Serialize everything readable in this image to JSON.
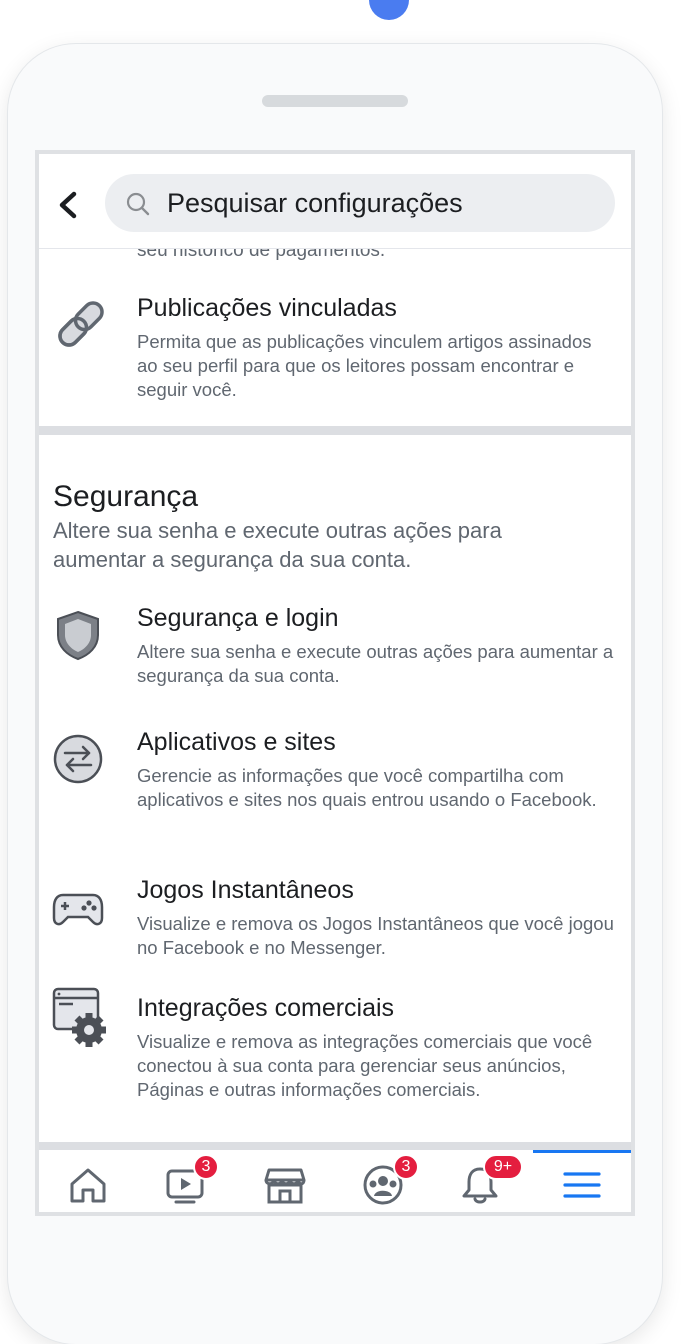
{
  "header": {
    "search_placeholder": "Pesquisar configurações",
    "cutoff_text": "seu histórico de pagamentos."
  },
  "linked_publications": {
    "title": "Publicações vinculadas",
    "description": "Permita que as publicações vinculem artigos assinados ao seu perfil para que os leitores possam encontrar e seguir você."
  },
  "security_section": {
    "title": "Segurança",
    "description": "Altere sua senha e execute outras ações para aumentar a segurança da sua conta.",
    "items": [
      {
        "icon": "shield-icon",
        "title": "Segurança e login",
        "description": "Altere sua senha e execute outras ações para aumentar a segurança da sua conta."
      },
      {
        "icon": "arrows-exchange-icon",
        "title": "Aplicativos e sites",
        "description": "Gerencie as informações que você compartilha com aplicativos e sites nos quais entrou usando o Facebook."
      },
      {
        "icon": "gamepad-icon",
        "title": "Jogos Instantâneos",
        "description": "Visualize e remova os Jogos Instantâneos que você jogou no Facebook e no Messenger."
      },
      {
        "icon": "browser-gear-icon",
        "title": "Integrações comerciais",
        "description": "Visualize e remova as integrações comerciais que você conectou à sua conta para gerenciar seus anúncios, Páginas e outras informações comerciais."
      }
    ]
  },
  "tabbar": {
    "items": [
      {
        "icon": "home-icon",
        "badge": ""
      },
      {
        "icon": "video-icon",
        "badge": "3"
      },
      {
        "icon": "marketplace-icon",
        "badge": ""
      },
      {
        "icon": "groups-icon",
        "badge": "3"
      },
      {
        "icon": "bell-icon",
        "badge": "9+"
      },
      {
        "icon": "menu-icon",
        "badge": "",
        "active": true
      }
    ]
  },
  "colors": {
    "accent": "#1877f2",
    "badge": "#e41e3f",
    "top_dot": "#4a7cf0"
  }
}
